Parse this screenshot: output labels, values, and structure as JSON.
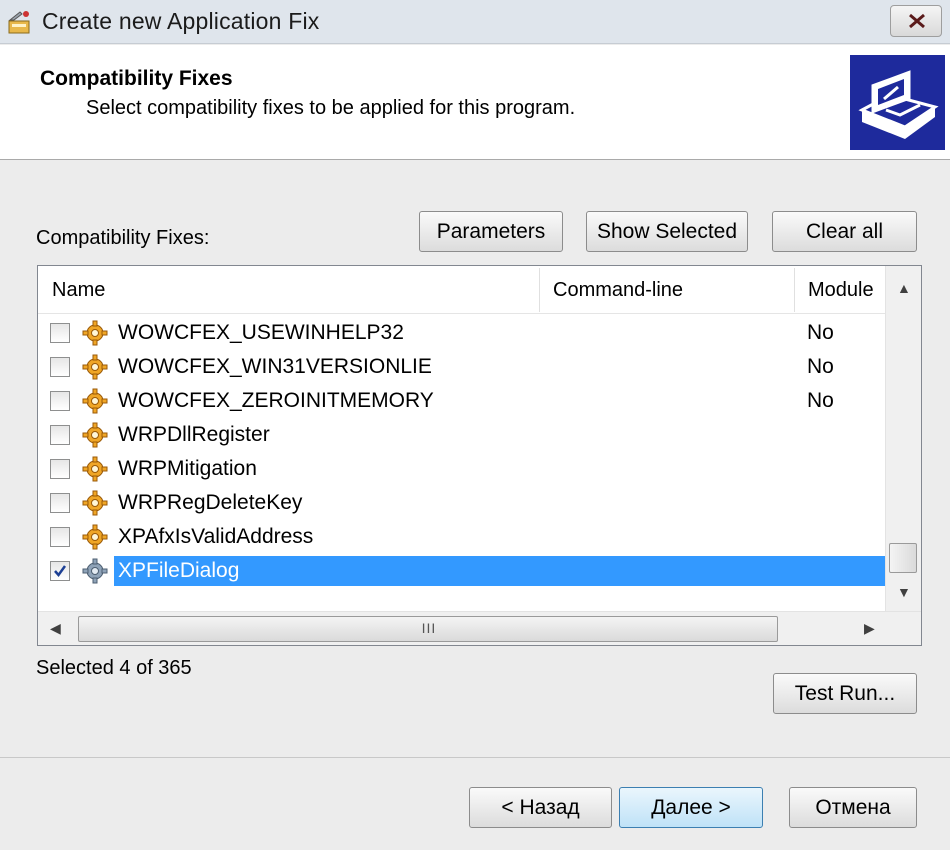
{
  "window": {
    "title": "Create new Application Fix"
  },
  "header": {
    "title": "Compatibility Fixes",
    "subtitle": "Select compatibility fixes to be applied for this program."
  },
  "toolbar": {
    "label": "Compatibility Fixes:",
    "parameters": "Parameters",
    "show_selected": "Show Selected",
    "clear_all": "Clear all"
  },
  "list": {
    "columns": [
      "Name",
      "Command-line",
      "Module"
    ],
    "rows": [
      {
        "name": "WOWCFEX_USEWINHELP32",
        "module": "No",
        "checked": false
      },
      {
        "name": "WOWCFEX_WIN31VERSIONLIE",
        "module": "No",
        "checked": false
      },
      {
        "name": "WOWCFEX_ZEROINITMEMORY",
        "module": "No",
        "checked": false
      },
      {
        "name": "WRPDllRegister",
        "module": "",
        "checked": false
      },
      {
        "name": "WRPMitigation",
        "module": "",
        "checked": false
      },
      {
        "name": "WRPRegDeleteKey",
        "module": "",
        "checked": false
      },
      {
        "name": "XPAfxIsValidAddress",
        "module": "",
        "checked": false
      },
      {
        "name": "XPFileDialog",
        "module": "",
        "checked": true,
        "selected": true
      }
    ],
    "hscroll_grip": "III"
  },
  "status": {
    "text": "Selected 4 of 365"
  },
  "test_run": "Test Run...",
  "footer": {
    "back": "< Назад",
    "next": "Далее >",
    "cancel": "Отмена"
  },
  "colors": {
    "selection": "#3399ff",
    "wizard_blue": "#1e2a9c"
  }
}
